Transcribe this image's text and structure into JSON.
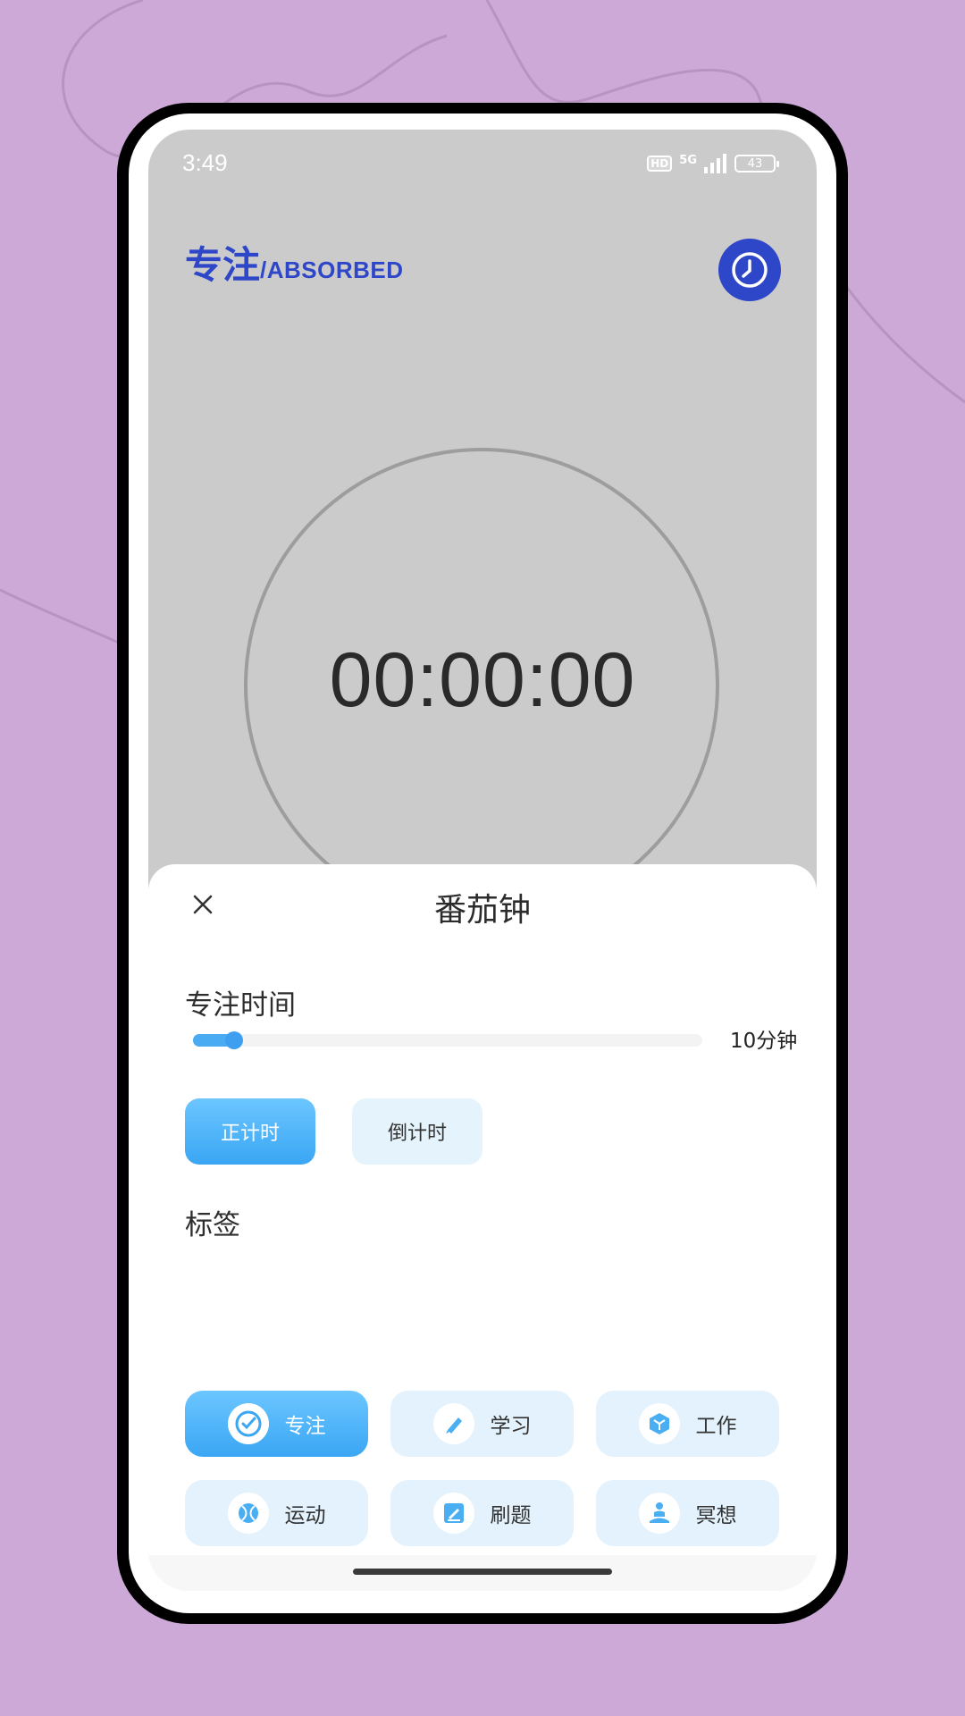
{
  "status_bar": {
    "time": "3:49",
    "hd": "HD",
    "network": "5G",
    "battery": "43"
  },
  "header": {
    "title_cn": "专注",
    "title_en": "/ABSORBED",
    "history_icon": "clock-icon"
  },
  "timer": {
    "display": "00:00:00"
  },
  "sheet": {
    "title": "番茄钟",
    "close_icon": "close-icon",
    "focus_time_label": "专注时间",
    "slider": {
      "value_text": "10分钟",
      "fraction": 0.08
    },
    "modes": {
      "count_up": "正计时",
      "count_down": "倒计时",
      "selected": "count_up"
    },
    "tags_label": "标签",
    "tags": [
      {
        "label": "专注",
        "icon": "target-icon",
        "active": true
      },
      {
        "label": "学习",
        "icon": "pen-icon",
        "active": false
      },
      {
        "label": "工作",
        "icon": "cube-icon",
        "active": false
      },
      {
        "label": "运动",
        "icon": "ball-icon",
        "active": false
      },
      {
        "label": "刷题",
        "icon": "edit-icon",
        "active": false
      },
      {
        "label": "冥想",
        "icon": "meditation-icon",
        "active": false
      }
    ]
  },
  "colors": {
    "accent": "#2e46c8",
    "primary_blue": "#3aa6f4",
    "background": "#cda9d8"
  }
}
